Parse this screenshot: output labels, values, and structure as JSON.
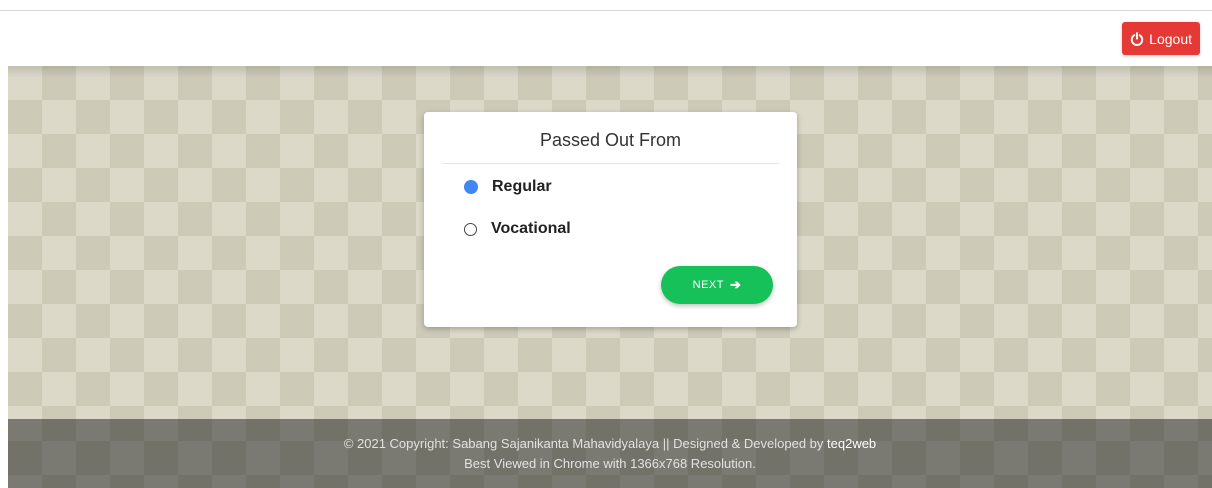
{
  "header": {
    "logout_label": "Logout",
    "logout_color": "#e53935"
  },
  "card": {
    "title": "Passed Out From",
    "options": [
      {
        "label": "Regular",
        "checked": true
      },
      {
        "label": "Vocational",
        "checked": false
      }
    ],
    "next_label": "NEXT",
    "next_color": "#16c15a"
  },
  "footer": {
    "line1_prefix": "© 2021 Copyright: Sabang Sajanikanta Mahavidyalaya || Designed & Developed by",
    "line1_brand": "teq2web",
    "line2": "Best Viewed in Chrome with 1366x768 Resolution."
  }
}
